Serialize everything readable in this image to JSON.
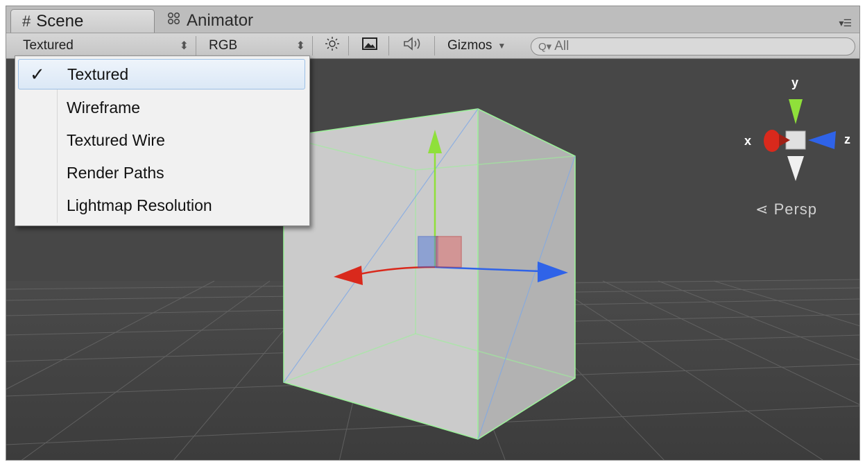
{
  "tabs": [
    {
      "label": "Scene",
      "icon": "hash-icon",
      "active": true
    },
    {
      "label": "Animator",
      "icon": "nodes-icon",
      "active": false
    }
  ],
  "toolbar": {
    "render_mode": "Textured",
    "color_mode": "RGB",
    "gizmos_label": "Gizmos",
    "search_placeholder": "All",
    "icons": [
      "lighting-icon",
      "image-icon",
      "audio-icon"
    ]
  },
  "render_menu": {
    "items": [
      "Textured",
      "Wireframe",
      "Textured Wire",
      "Render Paths",
      "Lightmap Resolution"
    ],
    "selected_index": 0
  },
  "viewport": {
    "projection_label": "Persp",
    "axis_labels": {
      "x": "x",
      "y": "y",
      "z": "z"
    }
  },
  "colors": {
    "viewport_bg": "#474747",
    "x_axis": "#d9291c",
    "y_axis": "#8fe03a",
    "z_axis": "#2f63e8",
    "selection_outline": "#9df09a"
  }
}
